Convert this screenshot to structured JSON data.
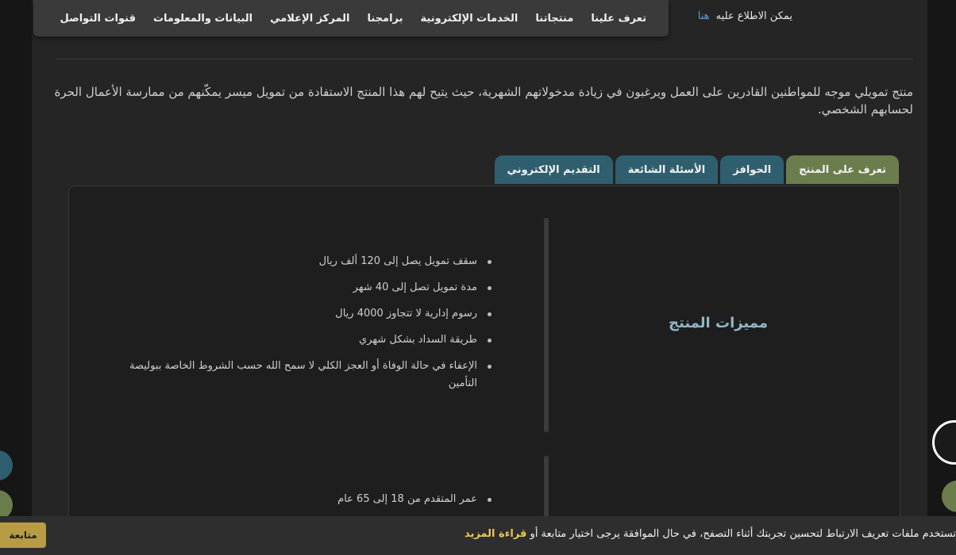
{
  "nav": {
    "items": [
      "تعرف علينا",
      "منتجاتنا",
      "الخدمات الإلكترونية",
      "برامجنا",
      "المركز الإعلامي",
      "البيانات والمعلومات",
      "قنوات التواصل"
    ]
  },
  "top_note": {
    "text": "يمكن الاطلاع عليه",
    "link": "هنا"
  },
  "intro": "منتج تمويلي موجه للمواطنين القادرين على العمل ويرغبون في زيادة مدخولاتهم الشهرية، حيث يتيح لهم هذا المنتج الاستفادة من تمويل ميسر يمكّنهم من ممارسة الأعمال الحرة لحسابهم الشخصي.",
  "tabs": [
    "تعرف على المنتج",
    "الحوافز",
    "الأسئلة الشائعة",
    "التقديم الإلكتروني"
  ],
  "panel": {
    "feature_title": "مميزات المنتج",
    "features": [
      "سقف تمويل يصل إلى 120 ألف ريال",
      "مدة تمويل تصل إلى 40 شهر",
      "رسوم إدارية لا تتجاوز 4000 ريال",
      "طريقة السداد بشكل شهري",
      "الإعفاء في حالة الوفاة أو العجز الكلي لا سمح الله حسب الشروط الخاصة ببوليصة التأمين"
    ],
    "conditions": [
      "عمر المتقدم من 18 إلى 65 عام"
    ]
  },
  "cookie": {
    "text": "تستخدم ملفات تعريف الارتباط لتحسين تجربتك أثناء التصفح، في حال الموافقة يرجى اختيار متابعة أو ",
    "more": "قراءة المزيد",
    "button": "متابعة"
  },
  "colors": {
    "tab_active": "#6b7d4c",
    "tab_default": "#2f5f6e",
    "accent_gold": "#b79c45",
    "feature_title": "#8fb7c8"
  }
}
